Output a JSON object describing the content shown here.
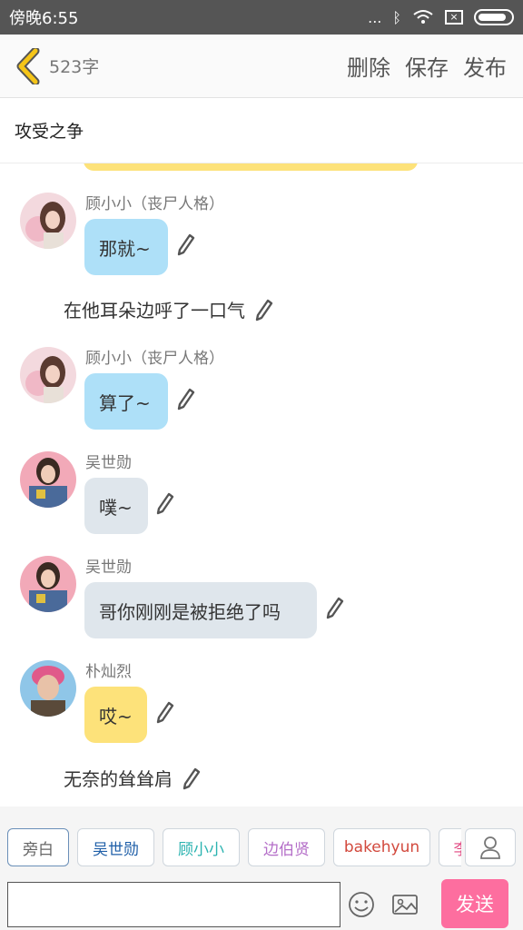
{
  "status_bar": {
    "time": "傍晚6:55",
    "signal_dots": "..."
  },
  "header": {
    "word_count": "523字",
    "delete_label": "删除",
    "save_label": "保存",
    "publish_label": "发布"
  },
  "story_title": "攻受之争",
  "messages": [
    {
      "name": "顾小小（丧尸人格）",
      "text": "那就~",
      "bubble_color": "#aee0f8"
    },
    {
      "narration": "在他耳朵边呼了一口气"
    },
    {
      "name": "顾小小（丧尸人格）",
      "text": "算了~",
      "bubble_color": "#aee0f8"
    },
    {
      "name": "吴世勋",
      "text": "噗~",
      "bubble_color": "#dfe6ec"
    },
    {
      "name": "吴世勋",
      "text": "哥你刚刚是被拒绝了吗",
      "bubble_color": "#dfe6ec"
    },
    {
      "name": "朴灿烈",
      "text": "哎~",
      "bubble_color": "#fde27a"
    },
    {
      "narration": "无奈的耸耸肩"
    }
  ],
  "characters": [
    {
      "label": "旁白",
      "color": "#666666"
    },
    {
      "label": "吴世勋",
      "color": "#1f5fa8"
    },
    {
      "label": "顾小小",
      "color": "#2bb3b0"
    },
    {
      "label": "边伯贤",
      "color": "#b46ec8"
    },
    {
      "label": "bakehyun",
      "color": "#d2493d"
    },
    {
      "label": "李",
      "color": "#e0447f"
    }
  ],
  "input": {
    "value": "",
    "placeholder": ""
  },
  "send_label": "发送"
}
